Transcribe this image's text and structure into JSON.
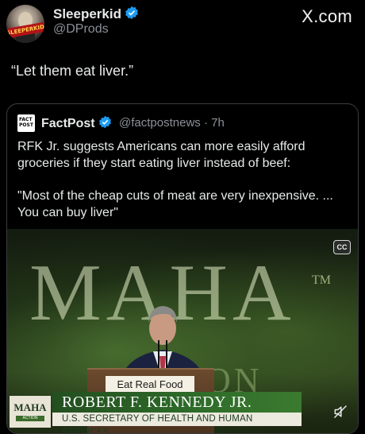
{
  "post": {
    "author_name": "Sleeperkid",
    "author_handle": "@DProds",
    "avatar_badge_text": "SLEEPERKID",
    "brand": "X.com",
    "text": "“Let them eat liver.”"
  },
  "quote": {
    "avatar_text": "FACT POST",
    "name": "FactPost",
    "meta": "@factpostnews · 7h",
    "text1": "RFK Jr. suggests Americans can more easily afford groceries if they start eating liver instead of beef:",
    "text2": "\"Most of the cheap cuts of meat are very inexpensive. ... You can buy liver\""
  },
  "video": {
    "backdrop_text": "MAHA",
    "trademark": "TM",
    "backdrop_text2": "ON",
    "podium_sign": "Eat Real Food",
    "cc_label": "CC",
    "chyron_logo": "MAHA",
    "chyron_logo_sub": "ACTION",
    "chyron_name": "ROBERT F. KENNEDY JR.",
    "chyron_title": "U.S. SECRETARY OF HEALTH AND HUMAN SERVICES",
    "mute_icon": "muted-speaker-icon"
  },
  "colors": {
    "verified": "#1d9bf0",
    "secondary_text": "#8b9097",
    "chyron_green": "#2f6d2a"
  }
}
